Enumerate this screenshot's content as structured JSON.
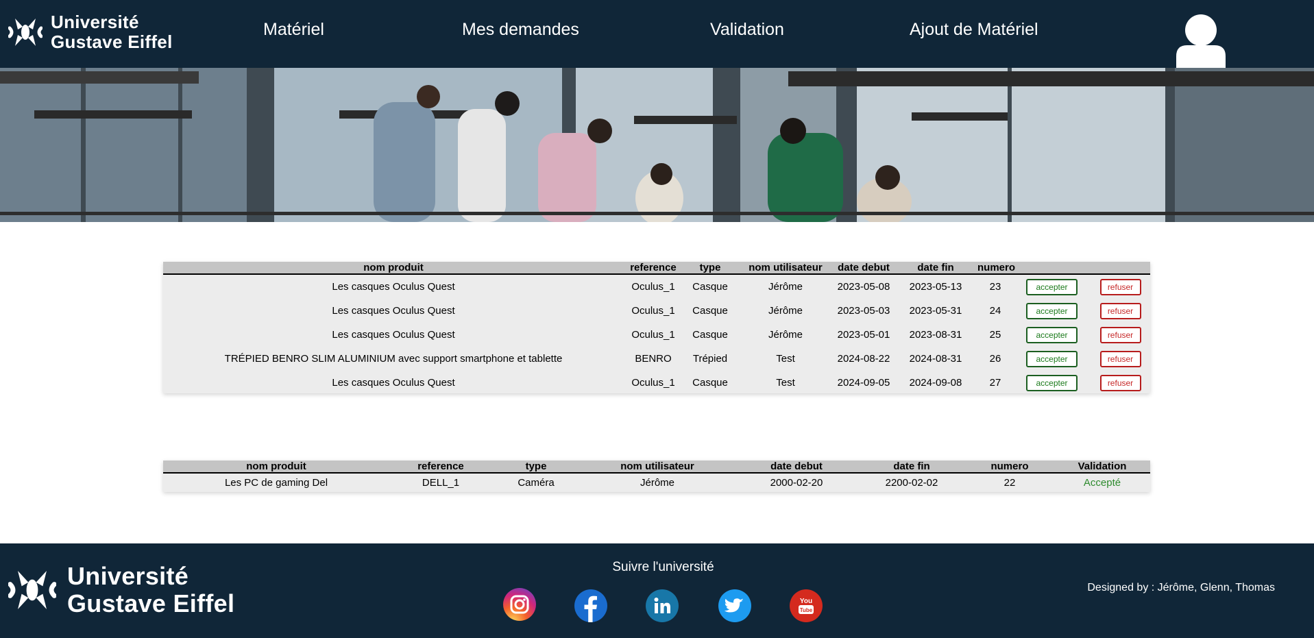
{
  "header": {
    "logo_line1": "Université",
    "logo_line2": "Gustave Eiffel",
    "nav": [
      "Matériel",
      "Mes demandes",
      "Validation",
      "Ajout de Matériel"
    ]
  },
  "requests": {
    "columns": [
      "nom produit",
      "reference",
      "type",
      "nom utilisateur",
      "date debut",
      "date fin",
      "numero",
      "",
      ""
    ],
    "accept_label": "accepter",
    "refuse_label": "refuser",
    "rows": [
      {
        "product": "Les casques Oculus Quest",
        "reference": "Oculus_1",
        "type": "Casque",
        "user": "Jérôme",
        "start": "2023-05-08",
        "end": "2023-05-13",
        "numero": "23"
      },
      {
        "product": "Les casques Oculus Quest",
        "reference": "Oculus_1",
        "type": "Casque",
        "user": "Jérôme",
        "start": "2023-05-03",
        "end": "2023-05-31",
        "numero": "24"
      },
      {
        "product": "Les casques Oculus Quest",
        "reference": "Oculus_1",
        "type": "Casque",
        "user": "Jérôme",
        "start": "2023-05-01",
        "end": "2023-08-31",
        "numero": "25"
      },
      {
        "product": "TRÉPIED BENRO SLIM ALUMINIUM avec support smartphone et tablette",
        "reference": "BENRO",
        "type": "Trépied",
        "user": "Test",
        "start": "2024-08-22",
        "end": "2024-08-31",
        "numero": "26"
      },
      {
        "product": "Les casques Oculus Quest",
        "reference": "Oculus_1",
        "type": "Casque",
        "user": "Test",
        "start": "2024-09-05",
        "end": "2024-09-08",
        "numero": "27"
      }
    ]
  },
  "history": {
    "columns": [
      "nom produit",
      "reference",
      "type",
      "nom utilisateur",
      "date debut",
      "date fin",
      "numero",
      "Validation"
    ],
    "rows": [
      {
        "product": "Les PC de gaming Del",
        "reference": "DELL_1",
        "type": "Caméra",
        "user": "Jérôme",
        "start": "2000-02-20",
        "end": "2200-02-02",
        "numero": "22",
        "status": "Accepté"
      }
    ]
  },
  "footer": {
    "logo_line1": "Université",
    "logo_line2": "Gustave Eiffel",
    "follow": "Suivre l'université",
    "credits": "Designed by : Jérôme, Glenn, Thomas",
    "social": [
      "instagram-icon",
      "facebook-icon",
      "linkedin-icon",
      "twitter-icon",
      "youtube-icon"
    ]
  },
  "colors": {
    "navy": "#102638",
    "table_header": "#c4c4c4",
    "table_body": "#ececec",
    "accept": "#1a7a1a",
    "refuse": "#c62828"
  }
}
